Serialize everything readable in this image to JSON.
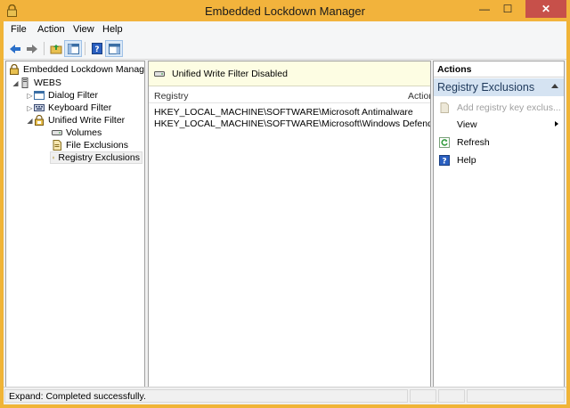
{
  "window": {
    "title": "Embedded Lockdown Manager",
    "close_glyph": "✕",
    "minimize_glyph": "—",
    "maximize_glyph": "☐"
  },
  "menu": [
    "File",
    "Action",
    "View",
    "Help"
  ],
  "toolbar": [
    "back-icon",
    "forward-icon",
    "up-folder-icon",
    "show-hide-tree-icon",
    "help-icon",
    "show-hide-action-pane-icon"
  ],
  "tree": {
    "root": "Embedded Lockdown Manager",
    "device": "WEBS",
    "items": {
      "dialog_filter": "Dialog Filter",
      "keyboard_filter": "Keyboard Filter",
      "uwf": "Unified Write Filter",
      "volumes": "Volumes",
      "file_exclusions": "File Exclusions",
      "registry_exclusions": "Registry Exclusions"
    },
    "arrows": {
      "collapsed": "▷",
      "expanded": "◢"
    }
  },
  "center": {
    "banner": "Unified Write Filter Disabled",
    "columns": {
      "registry": "Registry",
      "action": "Action"
    },
    "rows": [
      "HKEY_LOCAL_MACHINE\\SOFTWARE\\Microsoft Antimalware",
      "HKEY_LOCAL_MACHINE\\SOFTWARE\\Microsoft\\Windows Defender"
    ]
  },
  "actions": {
    "title": "Actions",
    "section": "Registry Exclusions",
    "items": {
      "add": "Add registry key exclus...",
      "view": "View",
      "refresh": "Refresh",
      "help": "Help"
    }
  },
  "status": {
    "text": "Expand:  Completed successfully."
  },
  "colors": {
    "titlebar": "#f2b33c",
    "close": "#c7504a",
    "actions_section": "#d5e3f2",
    "banner": "#fdfde3"
  }
}
